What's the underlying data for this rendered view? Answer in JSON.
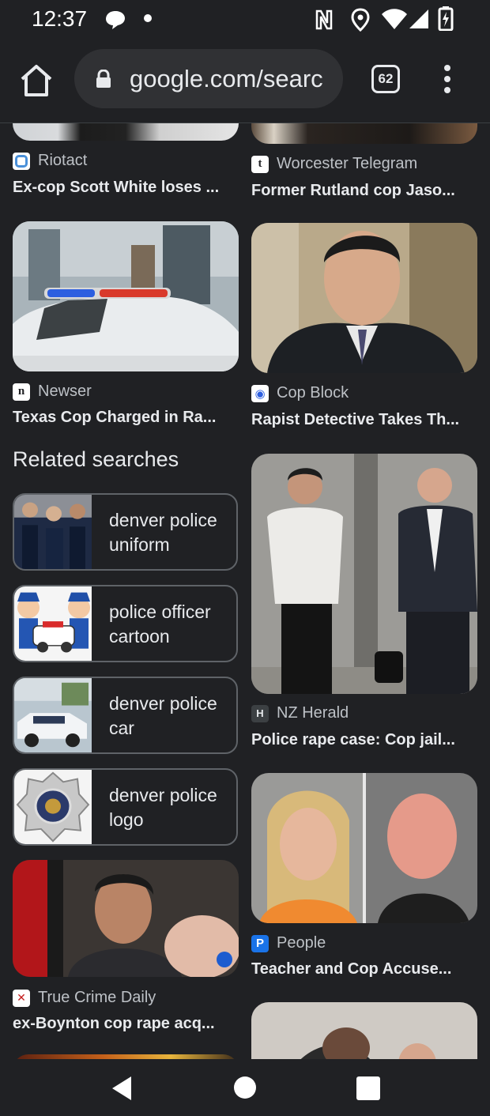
{
  "status_bar": {
    "time": "12:37"
  },
  "browser": {
    "url": "google.com/searc",
    "tab_count": "62"
  },
  "results": [
    {
      "source": "Riotact",
      "title": "Ex-cop Scott White loses ..."
    },
    {
      "source": "Worcester Telegram",
      "title": "Former Rutland cop Jaso..."
    },
    {
      "source": "Newser",
      "title": "Texas Cop Charged in Ra..."
    },
    {
      "source": "Cop Block",
      "title": "Rapist Detective Takes Th..."
    },
    {
      "source": "NZ Herald",
      "title": "Police rape case: Cop jail..."
    },
    {
      "source": "People",
      "title": "Teacher and Cop Accuse..."
    },
    {
      "source": "True Crime Daily",
      "title": "ex-Boynton cop rape acq..."
    }
  ],
  "related": {
    "heading": "Related searches",
    "items": [
      {
        "label": "denver police uniform"
      },
      {
        "label": "police officer cartoon"
      },
      {
        "label": "denver police car"
      },
      {
        "label": "denver police logo"
      }
    ]
  },
  "icons": [
    "chat-bubble-icon",
    "nfc-icon",
    "location-icon",
    "wifi-icon",
    "signal-icon",
    "battery-icon",
    "home-icon",
    "lock-icon",
    "tabs-icon",
    "more-icon",
    "back-icon",
    "home-circle-icon",
    "recents-icon"
  ]
}
